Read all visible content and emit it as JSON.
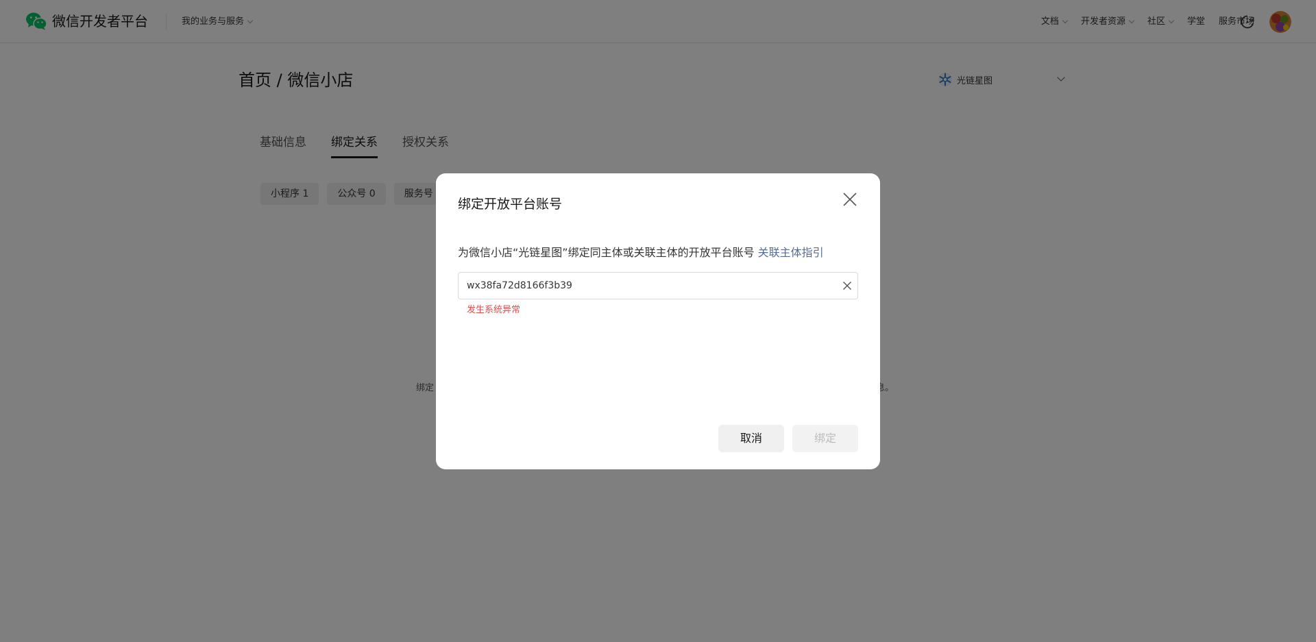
{
  "header": {
    "brand": "微信开发者平台",
    "biz_menu": "我的业务与服务",
    "nav": [
      {
        "label": "文档",
        "has_dropdown": true
      },
      {
        "label": "开发者资源",
        "has_dropdown": true
      },
      {
        "label": "社区",
        "has_dropdown": true
      },
      {
        "label": "学堂",
        "has_dropdown": false
      },
      {
        "label": "服务市场",
        "has_dropdown": false
      }
    ],
    "brand_color": "#07c160"
  },
  "page": {
    "breadcrumb": "首页 / 微信小店",
    "account_name": "光链星图",
    "tabs": [
      {
        "label": "基础信息",
        "active": false
      },
      {
        "label": "绑定关系",
        "active": true
      },
      {
        "label": "授权关系",
        "active": false
      }
    ],
    "chips": [
      "小程序 1",
      "公众号 0",
      "服务号"
    ],
    "empty_tip_start": "绑定",
    "empty_tip_end": "息。"
  },
  "dialog": {
    "title": "绑定开放平台账号",
    "desc_prefix": "为微信小店“光链星图”绑定同主体或关联主体的开放平台账号 ",
    "desc_link": "关联主体指引",
    "input_value": "wx38fa72d8166f3b39",
    "error_text": "发生系统异常",
    "cancel_label": "取消",
    "bind_label": "绑定",
    "link_color": "#576b95",
    "error_color": "#e84b4b"
  }
}
